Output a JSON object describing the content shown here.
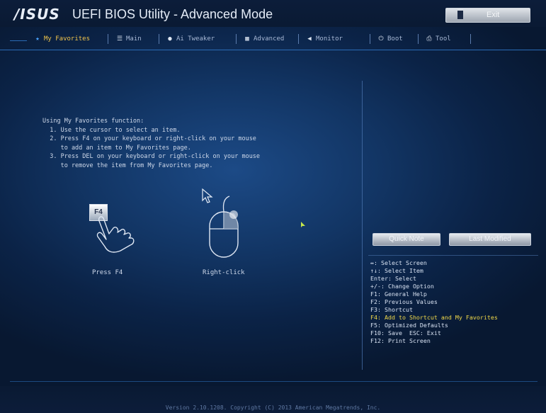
{
  "header": {
    "logo": "/ISUS",
    "title": "UEFI BIOS Utility - Advanced Mode",
    "exit_label": "Exit"
  },
  "tabs": [
    {
      "label": "My Favorites",
      "icon": "star-icon",
      "active": true
    },
    {
      "label": "Main",
      "icon": "list-icon",
      "active": false
    },
    {
      "label": "Ai Tweaker",
      "icon": "tweaker-icon",
      "active": false
    },
    {
      "label": "Advanced",
      "icon": "advanced-icon",
      "active": false
    },
    {
      "label": "Monitor",
      "icon": "monitor-icon",
      "active": false
    },
    {
      "label": "Boot",
      "icon": "power-icon",
      "active": false
    },
    {
      "label": "Tool",
      "icon": "printer-icon",
      "active": false
    }
  ],
  "instructions": {
    "heading": "Using My Favorites function:",
    "step1": "  1. Use the cursor to select an item.",
    "step2a": "  2. Press F4 on your keyboard or right-click on your mouse",
    "step2b": "     to add an item to My Favorites page.",
    "step3a": "  3. Press DEL on your keyboard or right-click on your mouse",
    "step3b": "     to remove the item from My Favorites page."
  },
  "illustration": {
    "key_label": "F4",
    "press_caption": "Press F4",
    "click_caption": "Right-click"
  },
  "buttons": {
    "quick_note": "Quick Note",
    "last_modified": "Last Modified"
  },
  "help": {
    "l1": "↔: Select Screen",
    "l2": "↑↓: Select Item",
    "l3": "Enter: Select",
    "l4": "+/-: Change Option",
    "l5": "F1: General Help",
    "l6": "F2: Previous Values",
    "l7": "F3: Shortcut",
    "l8": "F4: Add to Shortcut and My Favorites",
    "l9": "F5: Optimized Defaults",
    "l10": "F10: Save  ESC: Exit",
    "l11": "F12: Print Screen"
  },
  "footer": {
    "version": "Version 2.10.1208. Copyright (C) 2013 American Megatrends, Inc."
  },
  "colors": {
    "accent": "#f2c54a",
    "tab_line": "#2a6bb5",
    "highlight": "#f1d94a"
  }
}
